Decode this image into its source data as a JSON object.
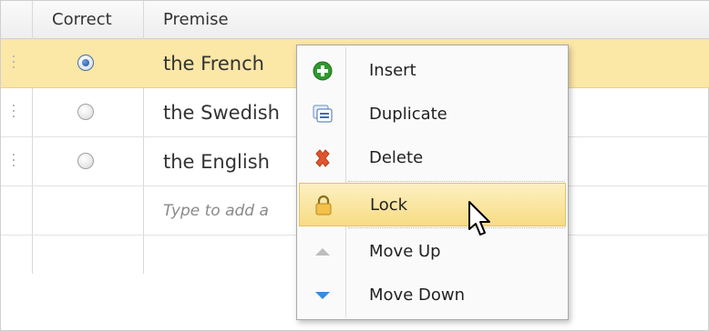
{
  "grid": {
    "columns": [
      "Correct",
      "Premise"
    ],
    "rows": [
      {
        "premise": "the French",
        "correct": true
      },
      {
        "premise": "the Swedish",
        "correct": false
      },
      {
        "premise": "the English",
        "correct": false
      }
    ],
    "new_row_placeholder": "Type to add a"
  },
  "context_menu": {
    "items": [
      {
        "label": "Insert",
        "icon": "insert-icon"
      },
      {
        "label": "Duplicate",
        "icon": "duplicate-icon"
      },
      {
        "label": "Delete",
        "icon": "delete-icon"
      },
      {
        "label": "Lock",
        "icon": "lock-icon",
        "highlighted": true
      },
      {
        "label": "Move Up",
        "icon": "move-up-icon",
        "disabled": true
      },
      {
        "label": "Move Down",
        "icon": "move-down-icon"
      }
    ]
  },
  "colors": {
    "selected_row": "#fbe7a6",
    "menu_hover": "#f7dc84",
    "insert_green": "#2e9a2e",
    "delete_red": "#e0552d",
    "move_down_blue": "#2f8fe0"
  }
}
